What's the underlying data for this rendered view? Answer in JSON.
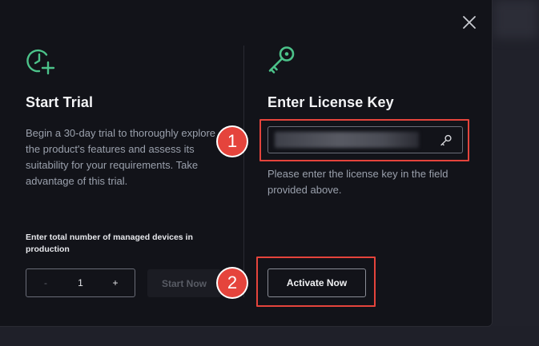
{
  "dialog": {
    "close_icon": "close-icon",
    "trial": {
      "icon": "clock-plus-icon",
      "title": "Start Trial",
      "description": "Begin a 30-day trial to thoroughly explore the product's features and assess its suitability for your requirements. Take advantage of this trial.",
      "devices_label": "Enter total number of managed devices in production",
      "stepper": {
        "minus": "-",
        "value": "1",
        "plus": "+"
      },
      "start_button": "Start Now"
    },
    "license": {
      "icon": "key-icon",
      "title": "Enter License Key",
      "input_value": "",
      "input_icon": "key-icon",
      "hint": "Please enter the license key in the field provided above.",
      "activate_button": "Activate Now"
    }
  },
  "annotations": {
    "step1": "1",
    "step2": "2",
    "color": "#e5443c"
  },
  "colors": {
    "accent_green": "#4cc38a",
    "modal_bg": "#121319"
  }
}
